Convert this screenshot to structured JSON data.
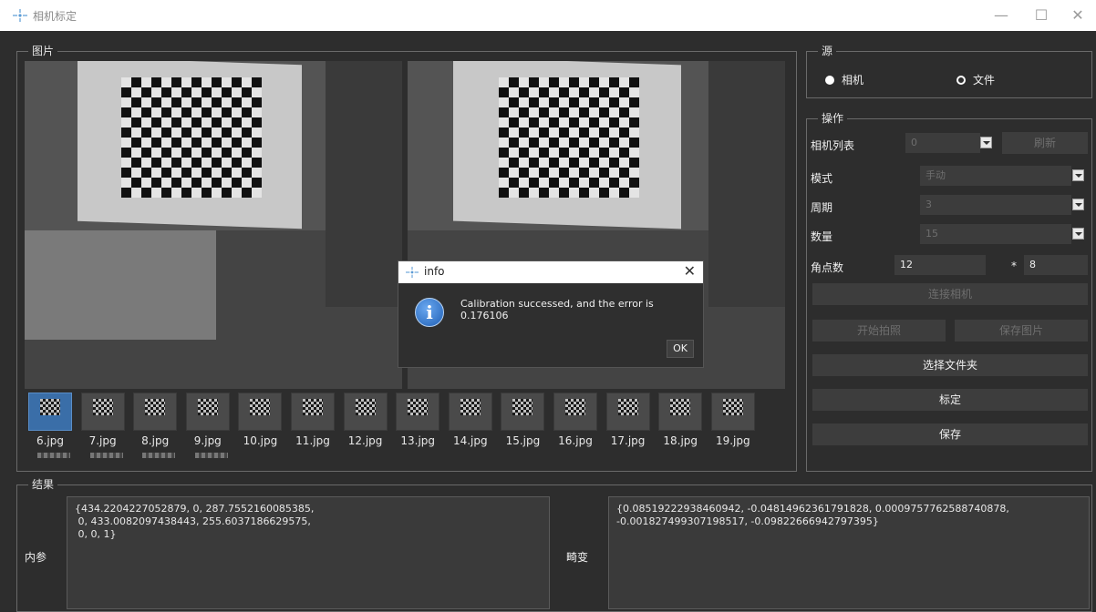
{
  "window": {
    "title": "相机标定",
    "minimize": "—",
    "maximize": "☐",
    "close": "✕"
  },
  "images_group": {
    "title": "图片",
    "thumbnails": [
      "6.jpg",
      "7.jpg",
      "8.jpg",
      "9.jpg",
      "10.jpg",
      "11.jpg",
      "12.jpg",
      "13.jpg",
      "14.jpg",
      "15.jpg",
      "16.jpg",
      "17.jpg",
      "18.jpg",
      "19.jpg"
    ],
    "selected": "6.jpg"
  },
  "source_group": {
    "title": "源",
    "camera_label": "相机",
    "file_label": "文件",
    "selected": "相机"
  },
  "ops_group": {
    "title": "操作",
    "camera_list_label": "相机列表",
    "camera_list_value": "0",
    "refresh_button": "刷新",
    "mode_label": "模式",
    "mode_value": "手动",
    "period_label": "周期",
    "period_value": "3",
    "count_label": "数量",
    "count_value": "15",
    "corners_label": "角点数",
    "corners_x": "12",
    "corners_sep": "*",
    "corners_y": "8",
    "connect_button": "连接相机",
    "start_capture_button": "开始拍照",
    "save_images_button": "保存图片",
    "select_folder_button": "选择文件夹",
    "calibrate_button": "标定",
    "save_button": "保存"
  },
  "results_group": {
    "title": "结果",
    "intrinsics_label": "内参",
    "intrinsics_value": "{434.2204227052879, 0, 287.7552160085385,\n 0, 433.0082097438443, 255.6037186629575,\n 0, 0, 1}",
    "distortion_label": "畸变",
    "distortion_value": "{0.08519222938460942, -0.04814962361791828, 0.0009757762588740878,\n-0.001827499307198517, -0.09822666942797395}"
  },
  "dialog": {
    "title": "info",
    "message": "Calibration successed, and the error is 0.176106",
    "ok_button": "OK",
    "close": "✕"
  }
}
